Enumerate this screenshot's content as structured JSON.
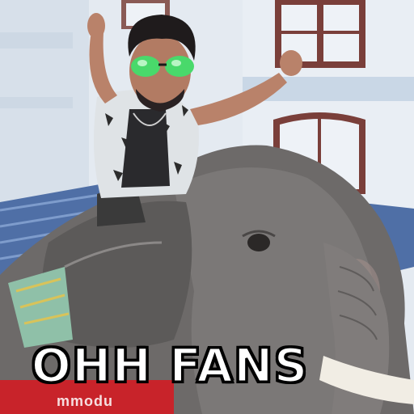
{
  "meme": {
    "caption": "OHH FANS",
    "banner_text": "mmodu"
  },
  "colors": {
    "sky_wall": "#e6ecf3",
    "window_frame": "#7a3f3a",
    "roof_blue": "#4f6fa6",
    "elephant": "#6f6c6b",
    "sunglasses": "#49d96b",
    "banner_red": "#c8232a"
  }
}
